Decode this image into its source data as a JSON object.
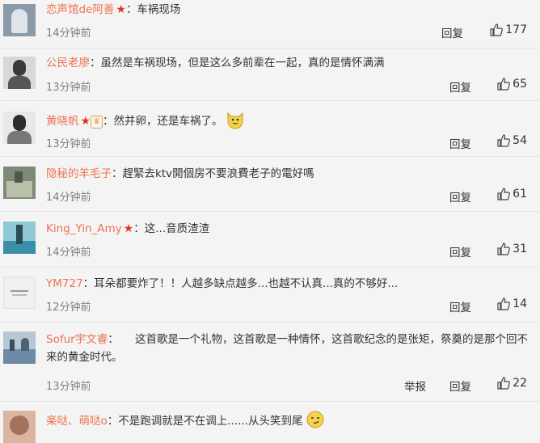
{
  "comments": [
    {
      "user": "恋声馆de阿善",
      "star": true,
      "badge": false,
      "text": "：车祸现场",
      "time": "14分钟前",
      "actions": [
        "回复"
      ],
      "likes": "177"
    },
    {
      "user": "公民老廖",
      "star": false,
      "badge": false,
      "text": "：虽然是车祸现场，但是这么多前辈在一起，真的是情怀满满",
      "time": "13分钟前",
      "actions": [
        "回复"
      ],
      "likes": "65"
    },
    {
      "user": "黄晓帆",
      "star": true,
      "badge": true,
      "text": "：然并卵，还是车祸了。",
      "time": "13分钟前",
      "actions": [
        "回复"
      ],
      "likes": "54"
    },
    {
      "user": "隐秘的羊毛子",
      "star": false,
      "badge": false,
      "text": "：趕緊去ktv開個房不要浪費老子的電好嗎",
      "time": "14分钟前",
      "actions": [
        "回复"
      ],
      "likes": "61"
    },
    {
      "user": "King_Yin_Amy",
      "star": true,
      "badge": false,
      "text": "：这...音质渣渣",
      "time": "14分钟前",
      "actions": [
        "回复"
      ],
      "likes": "31"
    },
    {
      "user": "YM727",
      "star": false,
      "badge": false,
      "text": "：耳朵都要炸了！！人越多缺点越多...也越不认真...真的不够好...",
      "time": "12分钟前",
      "actions": [
        "回复"
      ],
      "likes": "14"
    },
    {
      "user": "Sofur宇文睿",
      "star": false,
      "badge": false,
      "text": "：　　这首歌是一个礼物，这首歌是一种情怀，这首歌纪念的是张矩，祭奠的是那个回不来的黄金时代。",
      "time": "13分钟前",
      "actions": [
        "举报",
        "回复"
      ],
      "likes": "22"
    },
    {
      "user": "楽哒、萌哒o",
      "star": false,
      "badge": false,
      "text": "：不是跑调就是不在调上......从头笑到尾",
      "time": "",
      "actions": [],
      "likes": ""
    }
  ],
  "colors": {
    "username": "#eb7350",
    "time": "#808080",
    "background": "#f4f4f4"
  }
}
